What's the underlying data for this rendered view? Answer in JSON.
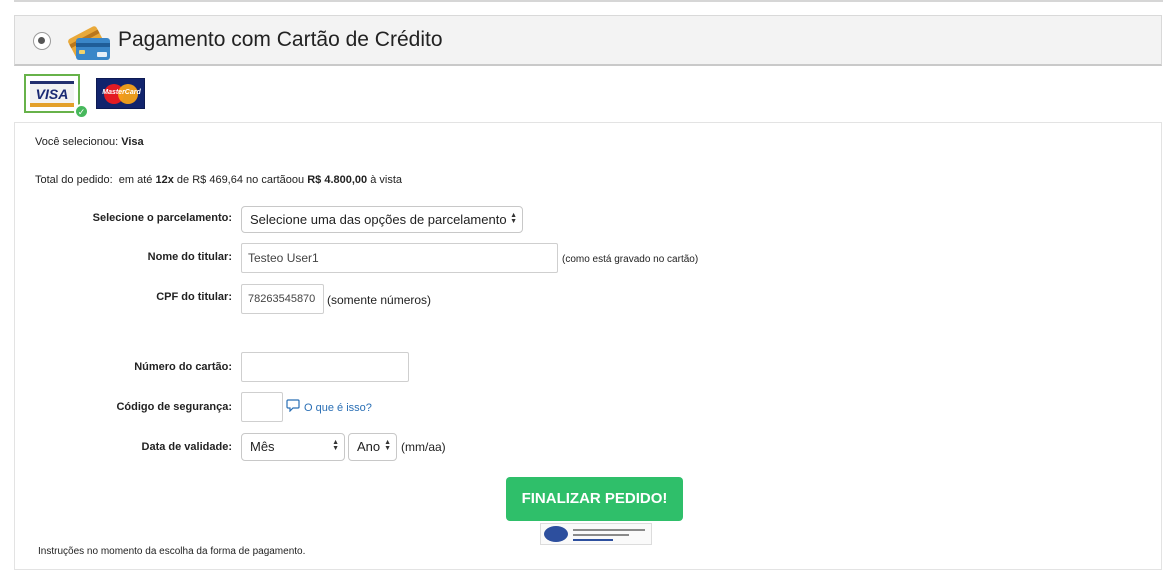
{
  "payment_option": {
    "title": "Pagamento com Cartão de Crédito",
    "icon": "credit-cards-icon"
  },
  "brands": [
    {
      "name": "VISA",
      "selected": true
    },
    {
      "name": "MasterCard",
      "selected": false
    }
  ],
  "summary": {
    "selected_prefix": "Você selecionou:",
    "selected_brand": "Visa",
    "total_label": "Total do pedido:",
    "total_mid1": "em até",
    "installments_count": "12x",
    "total_mid2": "de R$ 469,64 no cartãoou",
    "cash_total": "R$ 4.800,00",
    "total_suffix": "à vista"
  },
  "form": {
    "installments_label": "Selecione o parcelamento:",
    "installments_value": "Selecione uma das opções de parcelamento",
    "holder_label": "Nome do titular:",
    "holder_value": "Testeo User1",
    "holder_hint": "(como está gravado no cartão)",
    "cpf_label": "CPF do titular:",
    "cpf_value": "78263545870",
    "cpf_hint": "(somente números)",
    "card_number_label": "Número do cartão:",
    "card_number_value": "",
    "security_label": "Código de segurança:",
    "security_value": "",
    "security_link": "O que é isso?",
    "expiry_label": "Data de validade:",
    "month_value": "Mês",
    "year_value": "Ano",
    "expiry_hint": "(mm/aa)"
  },
  "submit_label": "FINALIZAR PEDIDO!",
  "footer_note": "Instruções no momento da escolha da forma de pagamento.",
  "colors": {
    "submit": "#2fbf6a",
    "link": "#2a6fb5",
    "selected_border": "#67b24a"
  }
}
